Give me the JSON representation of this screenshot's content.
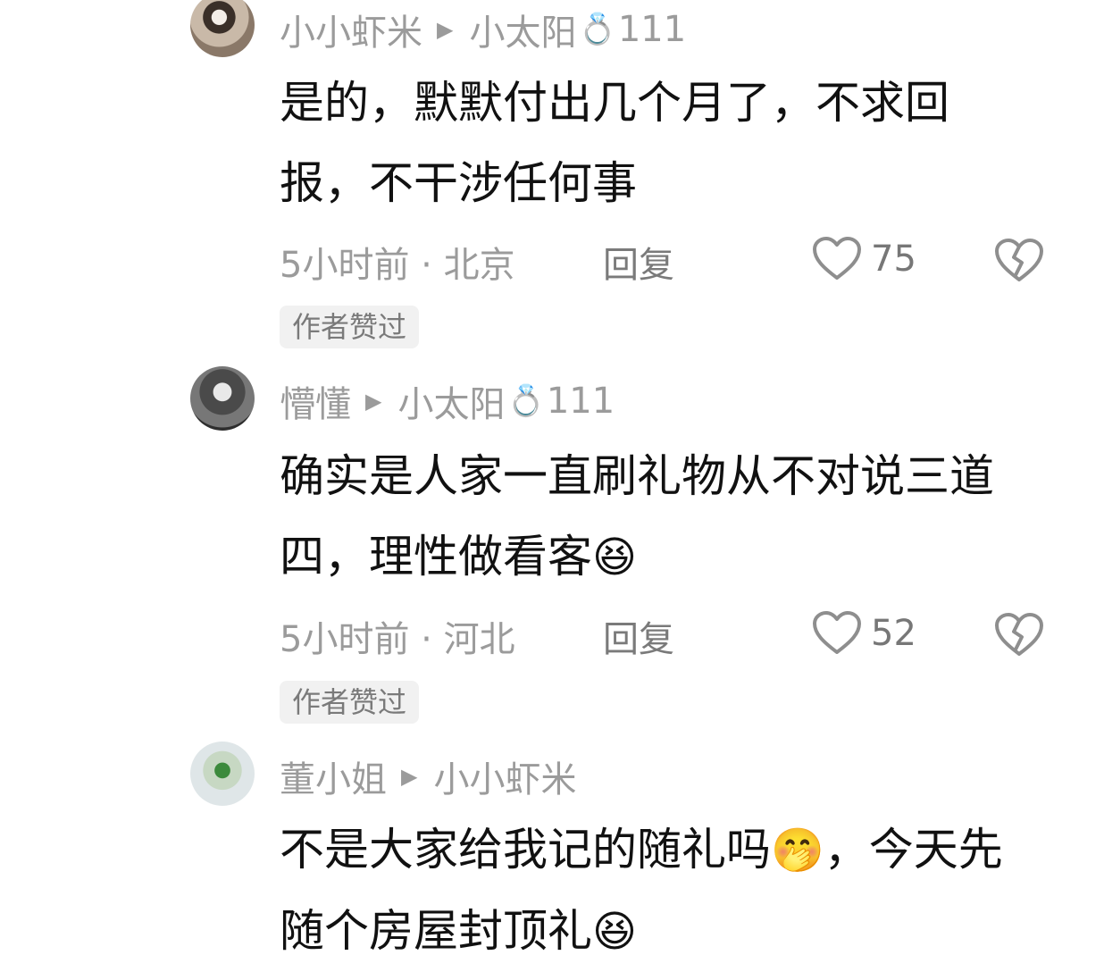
{
  "comments": [
    {
      "author": "小小虾米",
      "reply_to": "小太阳",
      "reply_to_badge_icon": "diamond-ring",
      "reply_to_level": "111",
      "text_line1": "是的，默默付出几个月了，不求回",
      "text_line2": "报，不干涉任何事",
      "time": "5小时前",
      "location": "北京",
      "reply_label": "回复",
      "like_count": "75",
      "badge": "作者赞过"
    },
    {
      "author": "懵懂",
      "reply_to": "小太阳",
      "reply_to_badge_icon": "diamond-ring",
      "reply_to_level": "111",
      "text_line1": "确实是人家一直刷礼物从不对说三道",
      "text_line2": "四，理性做看客",
      "emoji": "laughing-face",
      "time": "5小时前",
      "location": "河北",
      "reply_label": "回复",
      "like_count": "52",
      "badge": "作者赞过"
    },
    {
      "author": "董小姐",
      "reply_to": "小小虾米",
      "text_line1": "不是大家给我记的随礼吗",
      "text_line1_tail": "，今天先",
      "emoji": "smirking-face",
      "text_line2": "随个房屋封顶礼",
      "emoji2": "grinning-squint-face"
    }
  ],
  "separator": "·"
}
